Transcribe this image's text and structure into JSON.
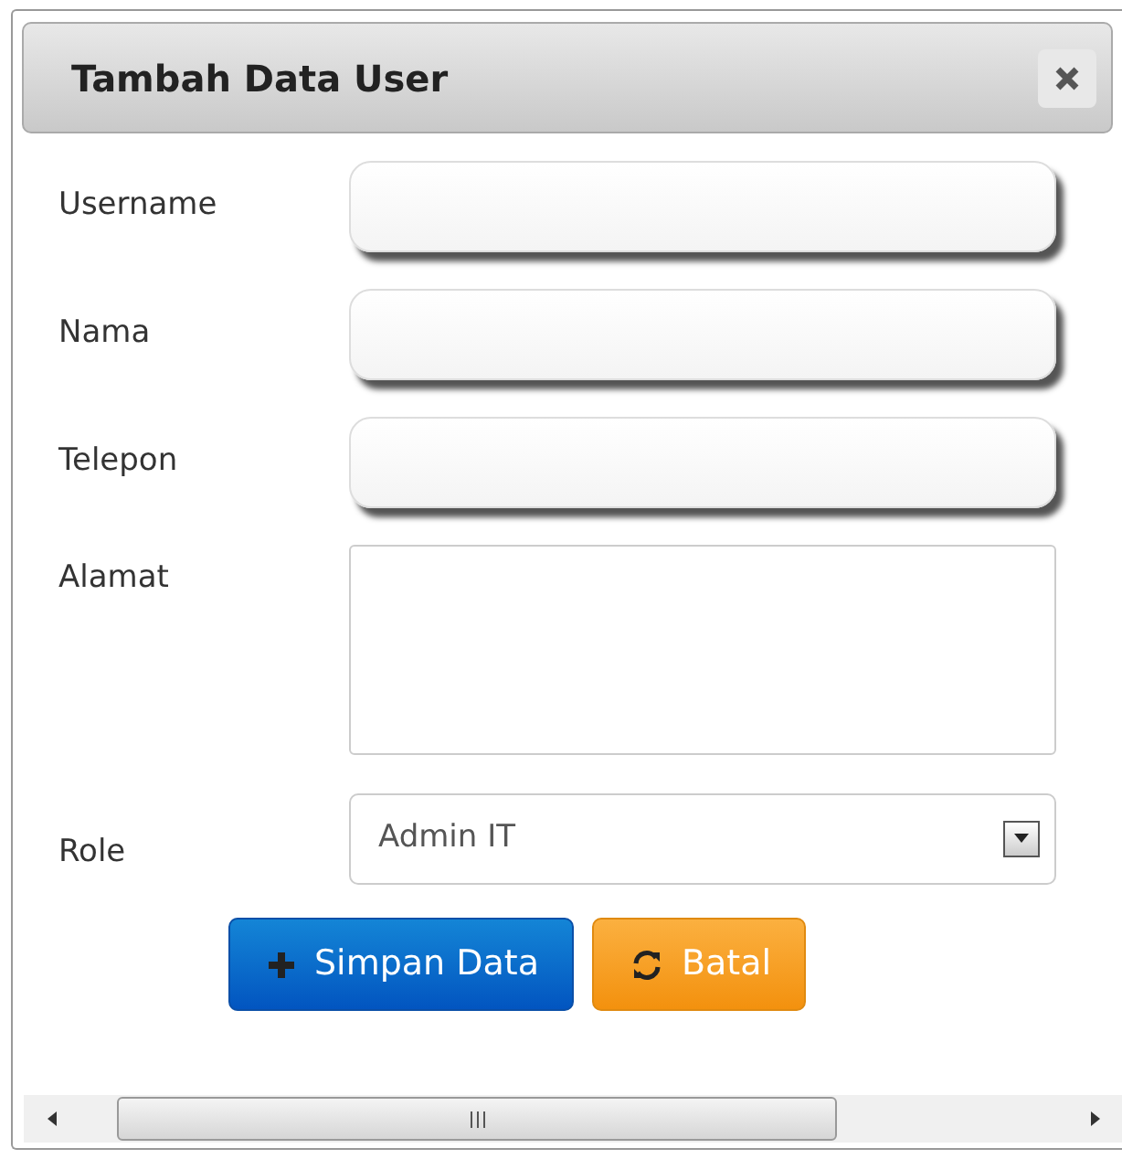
{
  "dialog": {
    "title": "Tambah Data User"
  },
  "fields": [
    {
      "label": "Username",
      "kind": "text"
    },
    {
      "label": "Nama",
      "kind": "text"
    },
    {
      "label": "Telepon",
      "kind": "text"
    },
    {
      "label": "Alamat",
      "kind": "textarea"
    },
    {
      "label": "Role",
      "kind": "select",
      "value": "Admin IT"
    }
  ],
  "buttons": [
    {
      "label": "Simpan Data",
      "kind": "primary"
    },
    {
      "label": "Batal",
      "kind": "warning"
    }
  ]
}
